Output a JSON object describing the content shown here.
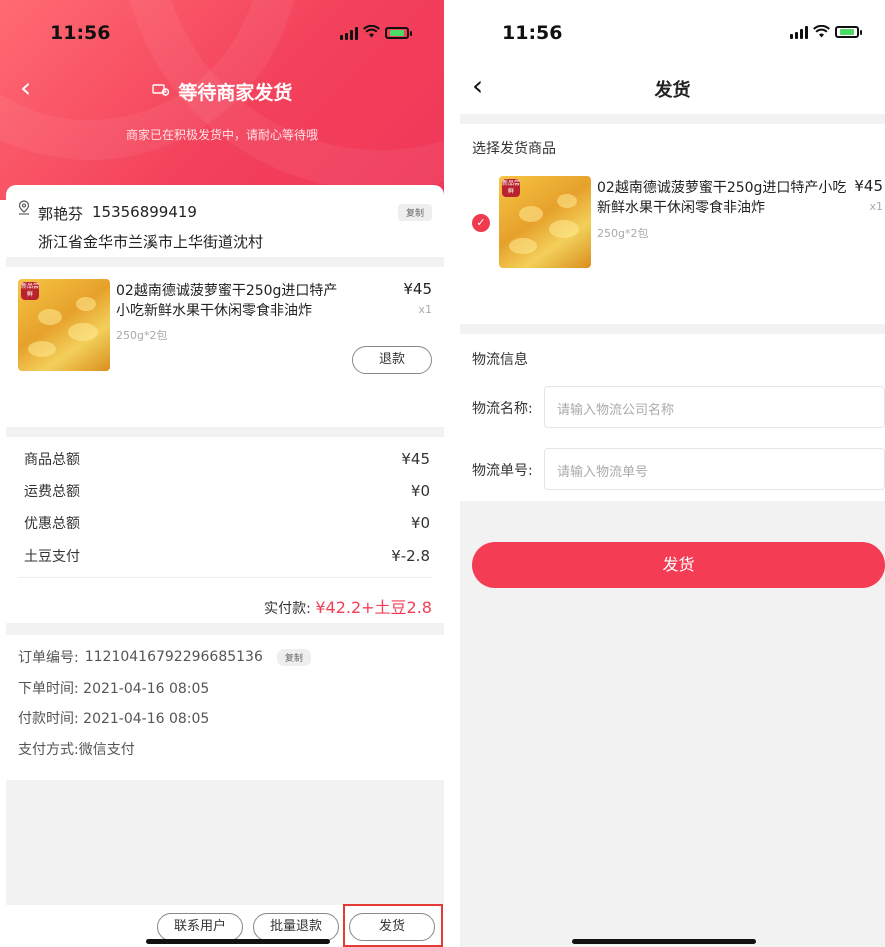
{
  "status_bar": {
    "time": "11:56"
  },
  "left": {
    "title": "等待商家发货",
    "subtitle": "商家已在积极发货中，请耐心等待哦",
    "address": {
      "name": "郭艳芬",
      "phone": "15356899419",
      "copy_label": "复制",
      "detail": "浙江省金华市兰溪市上华街道沈村"
    },
    "product": {
      "badge": "新品尝鲜",
      "title_line1": "02越南德诚菠萝蜜干250g进口特产",
      "title_line2": "小吃新鲜水果干休闲零食非油炸",
      "price": "¥45",
      "qty": "x1",
      "spec": "250g*2包",
      "refund_label": "退款"
    },
    "totals": [
      {
        "label": "商品总额",
        "value": "¥45"
      },
      {
        "label": "运费总额",
        "value": "¥0"
      },
      {
        "label": "优惠总额",
        "value": "¥0"
      },
      {
        "label": "土豆支付",
        "value": "¥-2.8"
      }
    ],
    "paid": {
      "label": "实付款:",
      "amount": "¥42.2+土豆2.8"
    },
    "order": {
      "number_label": "订单编号:",
      "number_value": "11210416792296685136",
      "copy_label": "复制",
      "placed_label": "下单时间:",
      "placed_value": "2021-04-16 08:05",
      "paid_label": "付款时间:",
      "paid_value": "2021-04-16 08:05",
      "method_label": "支付方式:",
      "method_value": "微信支付"
    },
    "buttons": {
      "contact": "联系用户",
      "batch_refund": "批量退款",
      "ship": "发货"
    }
  },
  "right": {
    "title": "发货",
    "select_label": "选择发货商品",
    "product": {
      "badge": "新品尝鲜",
      "title_line1": "02越南德诚菠萝蜜干250g进口特产小吃",
      "title_line2": "新鲜水果干休闲零食非油炸",
      "price": "¥45",
      "qty": "x1",
      "spec": "250g*2包"
    },
    "logistics": {
      "section_title": "物流信息",
      "name_label": "物流名称:",
      "name_placeholder": "请输入物流公司名称",
      "number_label": "物流单号:",
      "number_placeholder": "请输入物流单号"
    },
    "submit_label": "发货"
  },
  "colors": {
    "accent": "#f43d55",
    "highlight_border": "#e53935"
  }
}
